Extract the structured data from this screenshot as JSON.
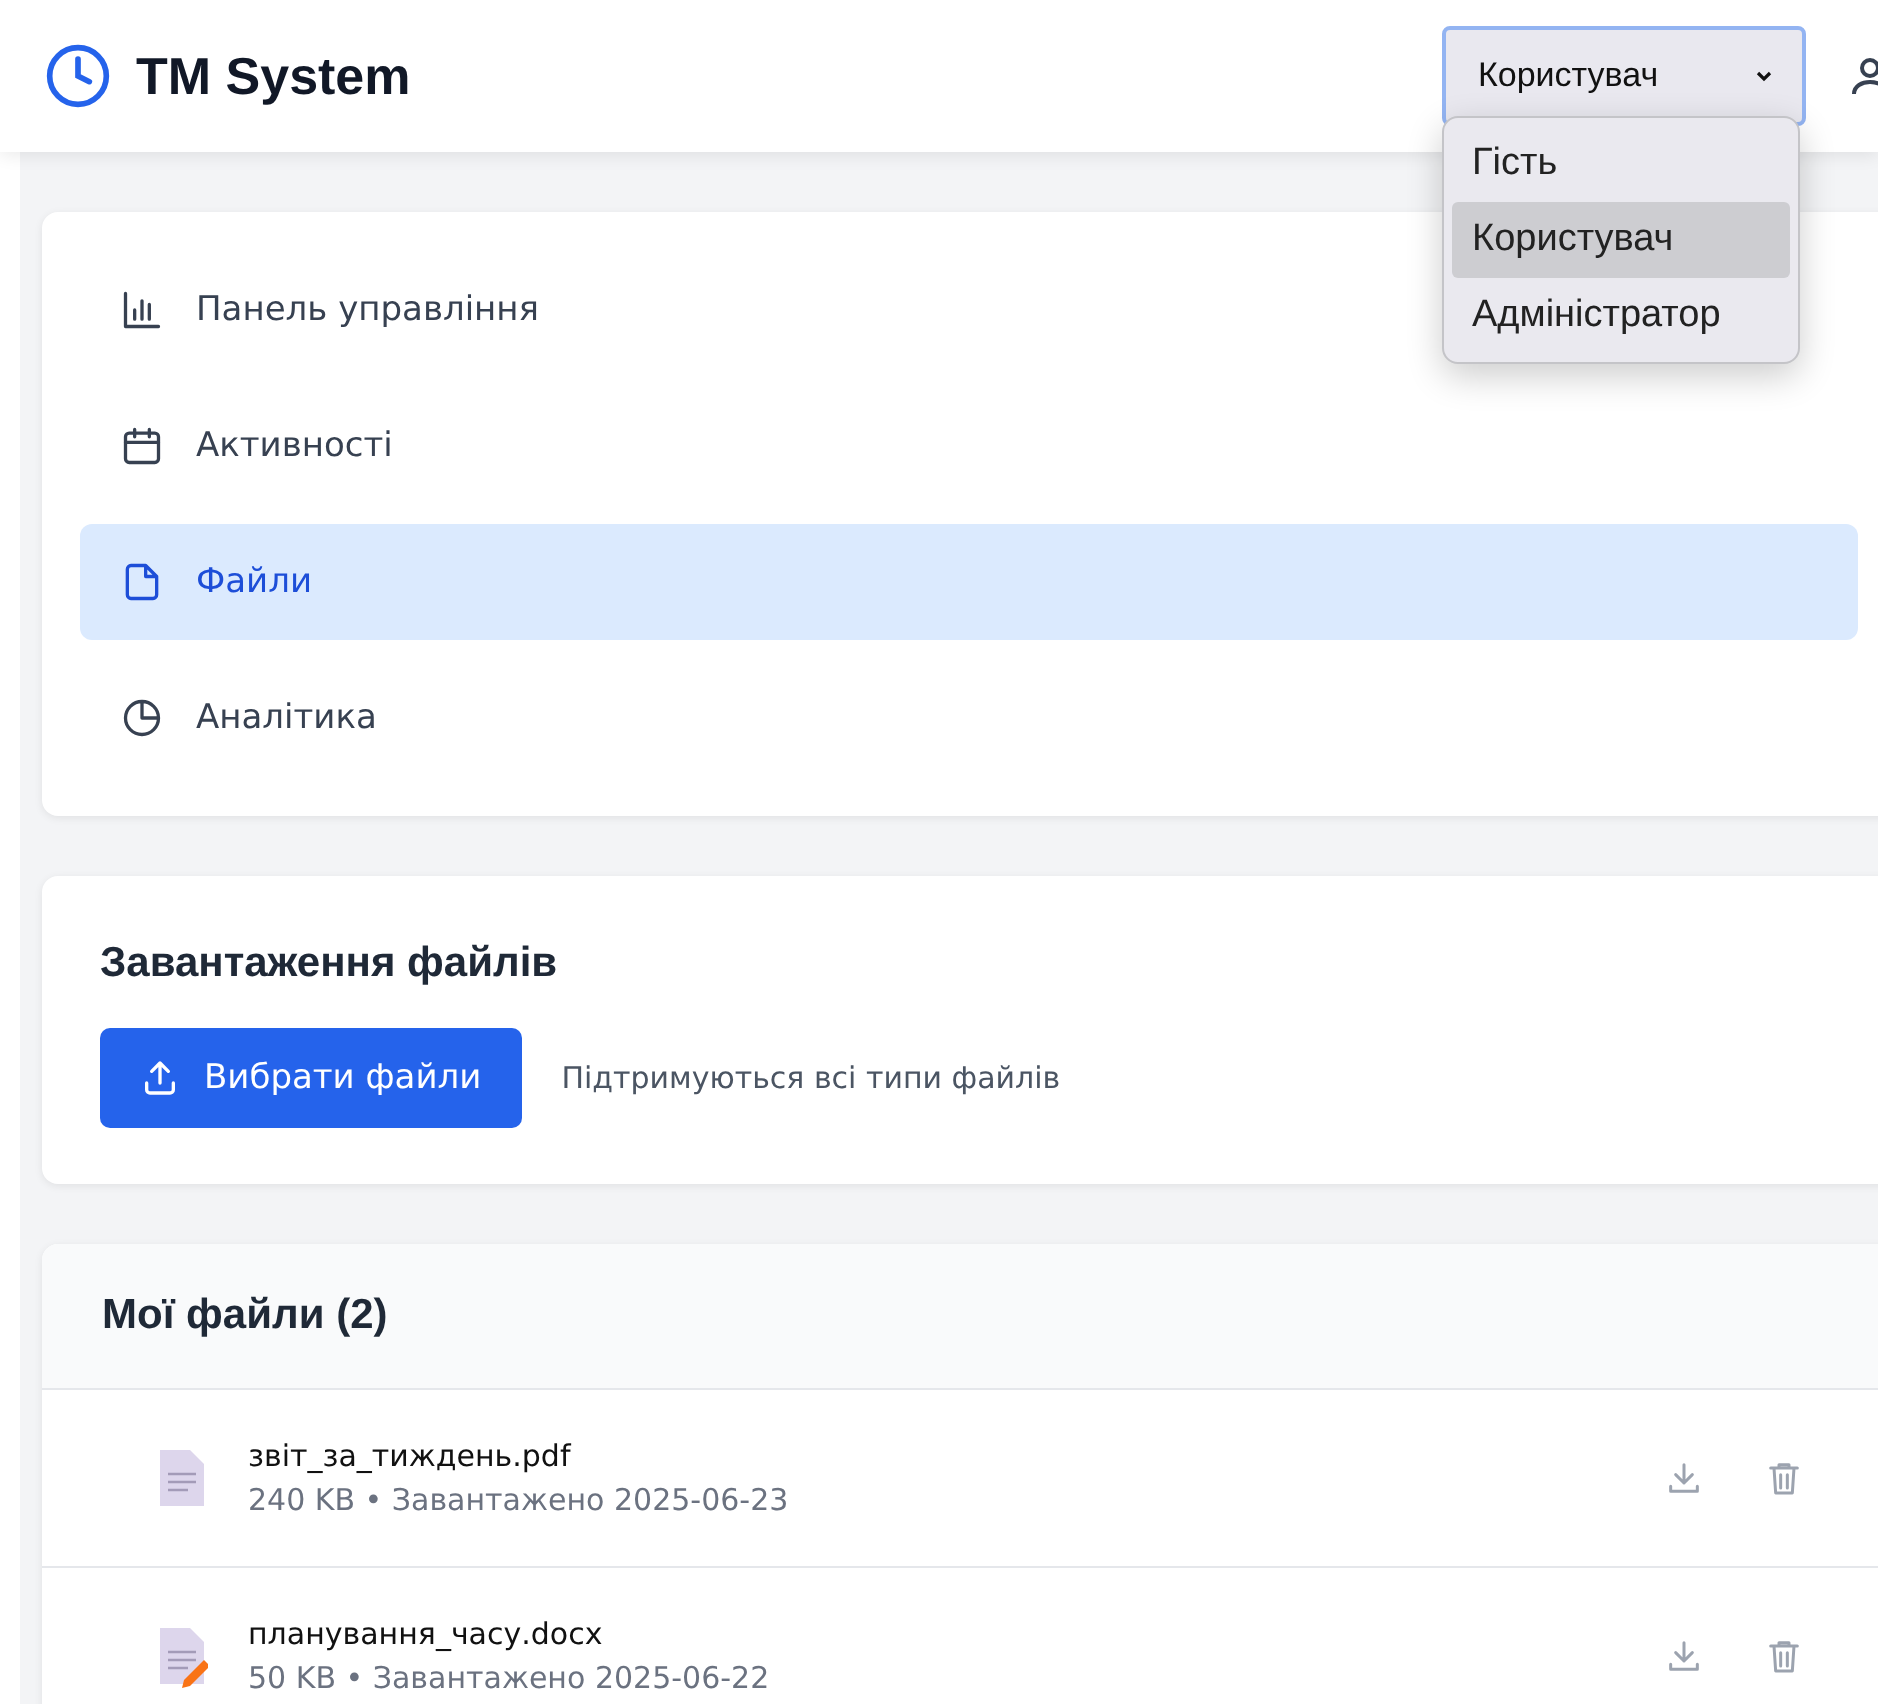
{
  "app": {
    "title": "TM System"
  },
  "role_select": {
    "value": "Користувач",
    "expanded": true,
    "options": [
      {
        "label": "Гість",
        "selected": false
      },
      {
        "label": "Користувач",
        "selected": true
      },
      {
        "label": "Адміністратор",
        "selected": false
      }
    ]
  },
  "nav": [
    {
      "kind": "chart",
      "label": "Панель управління",
      "selected": false
    },
    {
      "kind": "calendar",
      "label": "Активності",
      "selected": false
    },
    {
      "kind": "file",
      "label": "Файли",
      "selected": true
    },
    {
      "kind": "pie",
      "label": "Аналітика",
      "selected": false
    }
  ],
  "upload": {
    "title": "Завантаження файлів",
    "button": "Вибрати файли",
    "hint": "Підтримуються всі типи файлів"
  },
  "files": {
    "title": "Мої файли (2)",
    "items": [
      {
        "kind": "pdf",
        "name": "звіт_за_тиждень.pdf",
        "meta": "240 KB • Завантажено 2025-06-23"
      },
      {
        "kind": "docx",
        "name": "планування_часу.docx",
        "meta": "50 KB • Завантажено 2025-06-22"
      }
    ]
  }
}
